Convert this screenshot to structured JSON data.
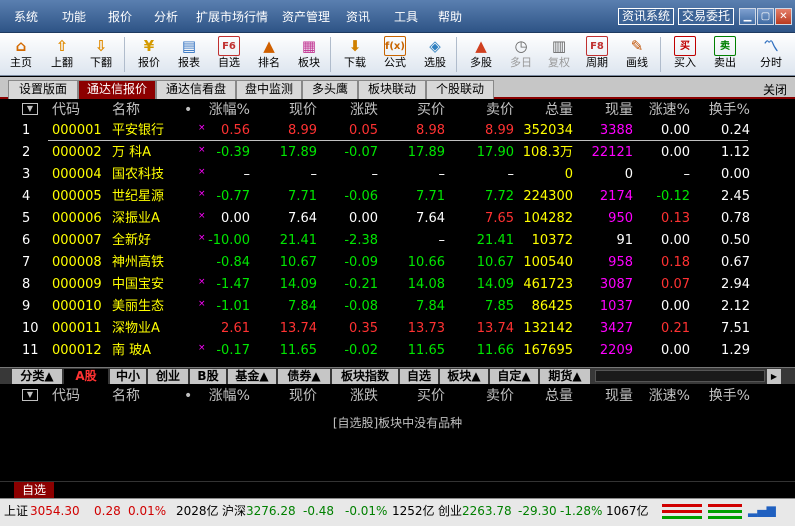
{
  "menu": [
    "系统",
    "功能",
    "报价",
    "分析",
    "扩展市场行情",
    "资产管理",
    "资讯",
    "工具",
    "帮助"
  ],
  "right_buttons": [
    "资讯系统",
    "交易委托"
  ],
  "toolbar": [
    {
      "label": "主页",
      "icon": "home-icon"
    },
    {
      "label": "上翻",
      "icon": "page-up-icon"
    },
    {
      "label": "下翻",
      "icon": "page-down-icon"
    },
    {
      "label": "报价",
      "icon": "quote-icon"
    },
    {
      "label": "报表",
      "icon": "report-icon"
    },
    {
      "label": "自选",
      "icon": "watchlist-icon",
      "glyph": "F6"
    },
    {
      "label": "排名",
      "icon": "ranking-icon"
    },
    {
      "label": "板块",
      "icon": "sector-icon"
    },
    {
      "label": "下载",
      "icon": "download-icon"
    },
    {
      "label": "公式",
      "icon": "formula-icon",
      "glyph": "f(x)"
    },
    {
      "label": "选股",
      "icon": "stock-picker-icon"
    },
    {
      "label": "多股",
      "icon": "multi-stock-icon"
    },
    {
      "label": "多日",
      "icon": "multi-day-icon",
      "disabled": true
    },
    {
      "label": "复权",
      "icon": "adjust-icon",
      "disabled": true
    },
    {
      "label": "周期",
      "icon": "period-icon",
      "glyph": "F8"
    },
    {
      "label": "画线",
      "icon": "draw-line-icon"
    },
    {
      "label": "买入",
      "icon": "buy-icon",
      "glyph": "买"
    },
    {
      "label": "卖出",
      "icon": "sell-icon",
      "glyph": "卖"
    },
    {
      "label": "分时",
      "icon": "intraday-icon"
    }
  ],
  "tabs": [
    "设置版面",
    "通达信报价",
    "通达信看盘",
    "盘中监测",
    "多头鹰",
    "板块联动",
    "个股联动"
  ],
  "close_label": "关闭",
  "columns": [
    "代码",
    "名称",
    "•",
    "涨幅%",
    "现价",
    "涨跌",
    "买价",
    "卖价",
    "总量",
    "现量",
    "涨速%",
    "换手%"
  ],
  "rows": [
    {
      "no": "1",
      "code": "000001",
      "name": "平安银行",
      "x": "×",
      "pct": "0.56",
      "price": "8.99",
      "chg": "0.05",
      "bid": "8.98",
      "ask": "8.99",
      "vol": "352034",
      "cur": "3388",
      "spd": "0.00",
      "turn": "0.24",
      "c": [
        "red",
        "red",
        "red",
        "red",
        "red",
        "y",
        "mag",
        "w",
        "w"
      ]
    },
    {
      "no": "2",
      "code": "000002",
      "name": "万 科A",
      "x": "×",
      "pct": "-0.39",
      "price": "17.89",
      "chg": "-0.07",
      "bid": "17.89",
      "ask": "17.90",
      "vol": "108.3万",
      "cur": "22121",
      "spd": "0.00",
      "turn": "1.12",
      "c": [
        "grn",
        "grn",
        "grn",
        "grn",
        "grn",
        "y",
        "mag",
        "w",
        "w"
      ]
    },
    {
      "no": "3",
      "code": "000004",
      "name": "国农科技",
      "x": "×",
      "pct": "–",
      "price": "–",
      "chg": "–",
      "bid": "–",
      "ask": "–",
      "vol": "0",
      "cur": "0",
      "spd": "–",
      "turn": "0.00",
      "c": [
        "w",
        "w",
        "w",
        "w",
        "w",
        "y",
        "w",
        "w",
        "w"
      ]
    },
    {
      "no": "4",
      "code": "000005",
      "name": "世纪星源",
      "x": "×",
      "pct": "-0.77",
      "price": "7.71",
      "chg": "-0.06",
      "bid": "7.71",
      "ask": "7.72",
      "vol": "224300",
      "cur": "2174",
      "spd": "-0.12",
      "turn": "2.45",
      "c": [
        "grn",
        "grn",
        "grn",
        "grn",
        "grn",
        "y",
        "mag",
        "grn",
        "w"
      ]
    },
    {
      "no": "5",
      "code": "000006",
      "name": "深振业A",
      "x": "×",
      "pct": "0.00",
      "price": "7.64",
      "chg": "0.00",
      "bid": "7.64",
      "ask": "7.65",
      "vol": "104282",
      "cur": "950",
      "spd": "0.13",
      "turn": "0.78",
      "c": [
        "w",
        "w",
        "w",
        "w",
        "red",
        "y",
        "mag",
        "red",
        "w"
      ]
    },
    {
      "no": "6",
      "code": "000007",
      "name": "全新好",
      "x": "×",
      "pct": "-10.00",
      "price": "21.41",
      "chg": "-2.38",
      "bid": "–",
      "ask": "21.41",
      "vol": "10372",
      "cur": "91",
      "spd": "0.00",
      "turn": "0.50",
      "c": [
        "grn",
        "grn",
        "grn",
        "w",
        "grn",
        "y",
        "w",
        "w",
        "w"
      ]
    },
    {
      "no": "7",
      "code": "000008",
      "name": "神州高铁",
      "x": "",
      "pct": "-0.84",
      "price": "10.67",
      "chg": "-0.09",
      "bid": "10.66",
      "ask": "10.67",
      "vol": "100540",
      "cur": "958",
      "spd": "0.18",
      "turn": "0.67",
      "c": [
        "grn",
        "grn",
        "grn",
        "grn",
        "grn",
        "y",
        "mag",
        "red",
        "w"
      ]
    },
    {
      "no": "8",
      "code": "000009",
      "name": "中国宝安",
      "x": "×",
      "pct": "-1.47",
      "price": "14.09",
      "chg": "-0.21",
      "bid": "14.08",
      "ask": "14.09",
      "vol": "461723",
      "cur": "3087",
      "spd": "0.07",
      "turn": "2.94",
      "c": [
        "grn",
        "grn",
        "grn",
        "grn",
        "grn",
        "y",
        "mag",
        "red",
        "w"
      ]
    },
    {
      "no": "9",
      "code": "000010",
      "name": "美丽生态",
      "x": "×",
      "pct": "-1.01",
      "price": "7.84",
      "chg": "-0.08",
      "bid": "7.84",
      "ask": "7.85",
      "vol": "86425",
      "cur": "1037",
      "spd": "0.00",
      "turn": "2.12",
      "c": [
        "grn",
        "grn",
        "grn",
        "grn",
        "grn",
        "y",
        "mag",
        "w",
        "w"
      ]
    },
    {
      "no": "10",
      "code": "000011",
      "name": "深物业A",
      "x": "",
      "pct": "2.61",
      "price": "13.74",
      "chg": "0.35",
      "bid": "13.73",
      "ask": "13.74",
      "vol": "132142",
      "cur": "3427",
      "spd": "0.21",
      "turn": "7.51",
      "c": [
        "red",
        "red",
        "red",
        "red",
        "red",
        "y",
        "mag",
        "red",
        "w"
      ]
    },
    {
      "no": "11",
      "code": "000012",
      "name": "南 玻A",
      "x": "×",
      "pct": "-0.17",
      "price": "11.65",
      "chg": "-0.02",
      "bid": "11.65",
      "ask": "11.66",
      "vol": "167695",
      "cur": "2209",
      "spd": "0.00",
      "turn": "1.29",
      "c": [
        "grn",
        "grn",
        "grn",
        "grn",
        "grn",
        "y",
        "mag",
        "w",
        "w"
      ]
    }
  ],
  "section_tabs": [
    "分类▲",
    "A股",
    "中小",
    "创业",
    "B股",
    "基金▲",
    "债券▲",
    "板块指数",
    "自选",
    "板块▲",
    "自定▲",
    "期货▲"
  ],
  "empty_message": "[自选股]板块中没有品种",
  "watchlist_tab": "自选",
  "status": {
    "sh_label": "上证",
    "sh_index": "3054.30",
    "sh_chg": "0.28",
    "sh_pct": "0.01%",
    "sh_amt": "2028亿",
    "hs_label": "沪深",
    "hs_index": "3276.28",
    "hs_chg": "-0.48",
    "hs_pct": "-0.01%",
    "hs_amt": "1252亿",
    "cy_label": "创业",
    "cy_index": "2263.78",
    "cy_chg": "-29.30",
    "cy_pct": "-1.28%",
    "cy_amt": "1067亿"
  }
}
